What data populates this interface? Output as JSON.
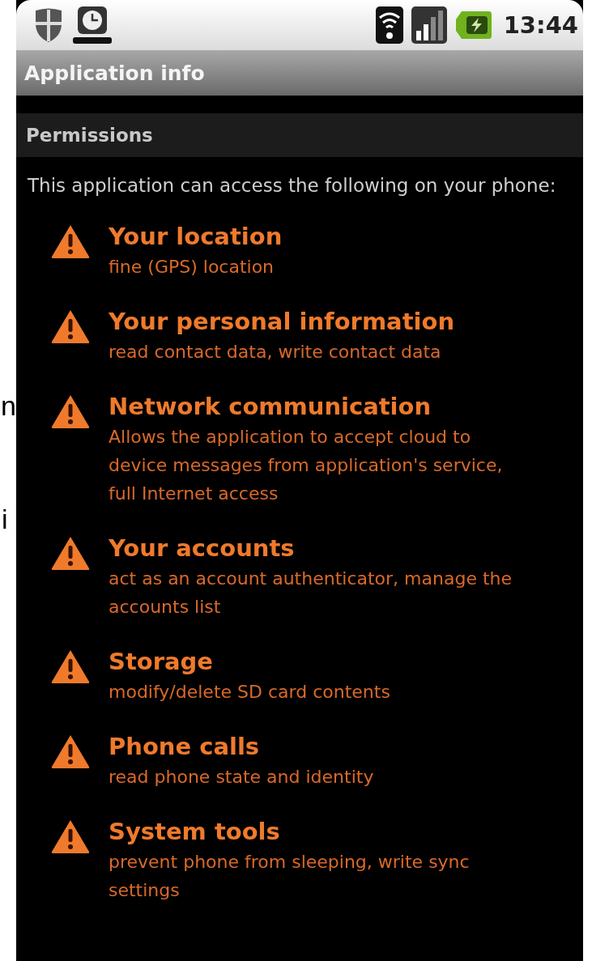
{
  "background_fragments": [
    "n",
    "i"
  ],
  "status_bar": {
    "time": "13:44"
  },
  "title_bar": {
    "title": "Application info"
  },
  "section": {
    "header": "Permissions",
    "intro": "This application can access the following on your phone:"
  },
  "permissions": [
    {
      "title": "Your location",
      "description": "fine (GPS) location"
    },
    {
      "title": "Your personal information",
      "description": "read contact data, write contact data"
    },
    {
      "title": "Network communication",
      "description": "Allows the application to accept cloud to device messages from application's service, full Internet access"
    },
    {
      "title": "Your accounts",
      "description": "act as an account authenticator, manage the accounts list"
    },
    {
      "title": "Storage",
      "description": "modify/delete SD card contents"
    },
    {
      "title": "Phone calls",
      "description": "read phone state and identity"
    },
    {
      "title": "System tools",
      "description": "prevent phone from sleeping, write sync settings"
    }
  ]
}
